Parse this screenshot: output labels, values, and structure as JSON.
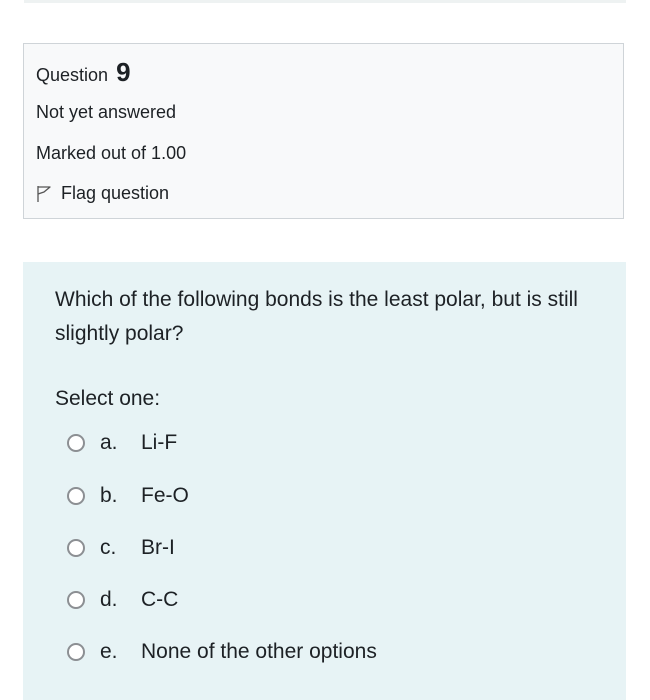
{
  "info": {
    "question_label": "Question",
    "question_number": "9",
    "state": "Not yet answered",
    "grade": "Marked out of 1.00",
    "flag_label": "Flag question",
    "flag_icon": "flag-outline-icon"
  },
  "question": {
    "text": "Which of the following bonds is the least polar, but is still slightly polar?",
    "prompt": "Select one:",
    "answers": [
      {
        "letter": "a.",
        "label": "Li-F"
      },
      {
        "letter": "b.",
        "label": "Fe-O"
      },
      {
        "letter": "c.",
        "label": "Br-I"
      },
      {
        "letter": "d.",
        "label": "C-C"
      },
      {
        "letter": "e.",
        "label": "None of the other options"
      }
    ]
  },
  "colors": {
    "info_bg": "#f8f9fa",
    "info_border": "#cfd4d8",
    "question_bg": "#e7f3f5",
    "text": "#1d2125"
  }
}
